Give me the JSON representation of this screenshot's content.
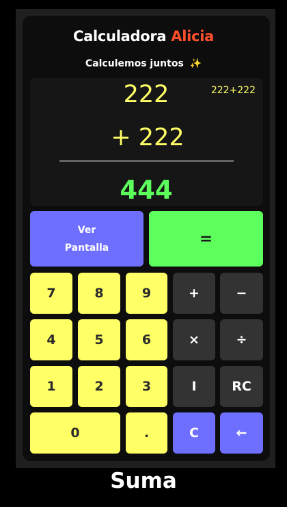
{
  "header": {
    "title_main": "Calculadora",
    "title_accent": "Alicia",
    "subtitle": "Calculemos juntos",
    "subtitle_icon": "✨"
  },
  "display": {
    "operand1": "222",
    "operand2": "+ 222",
    "expression": "222+222",
    "result": "444"
  },
  "buttons": {
    "view_line1": "Ver",
    "view_line2": "Pantalla",
    "equals": "=",
    "seven": "7",
    "eight": "8",
    "nine": "9",
    "plus": "+",
    "minus": "−",
    "four": "4",
    "five": "5",
    "six": "6",
    "multiply": "×",
    "divide": "÷",
    "one": "1",
    "two": "2",
    "three": "3",
    "integer": "I",
    "sqrt": "RC",
    "zero": "0",
    "dot": ".",
    "clear": "C",
    "backspace": "←"
  },
  "caption": "Suma",
  "colors": {
    "number_key": "#ffff66",
    "operator_key": "#333333",
    "accent_blue": "#6e6eff",
    "equals_green": "#5cff5c",
    "title_accent": "#ff4f2b"
  }
}
